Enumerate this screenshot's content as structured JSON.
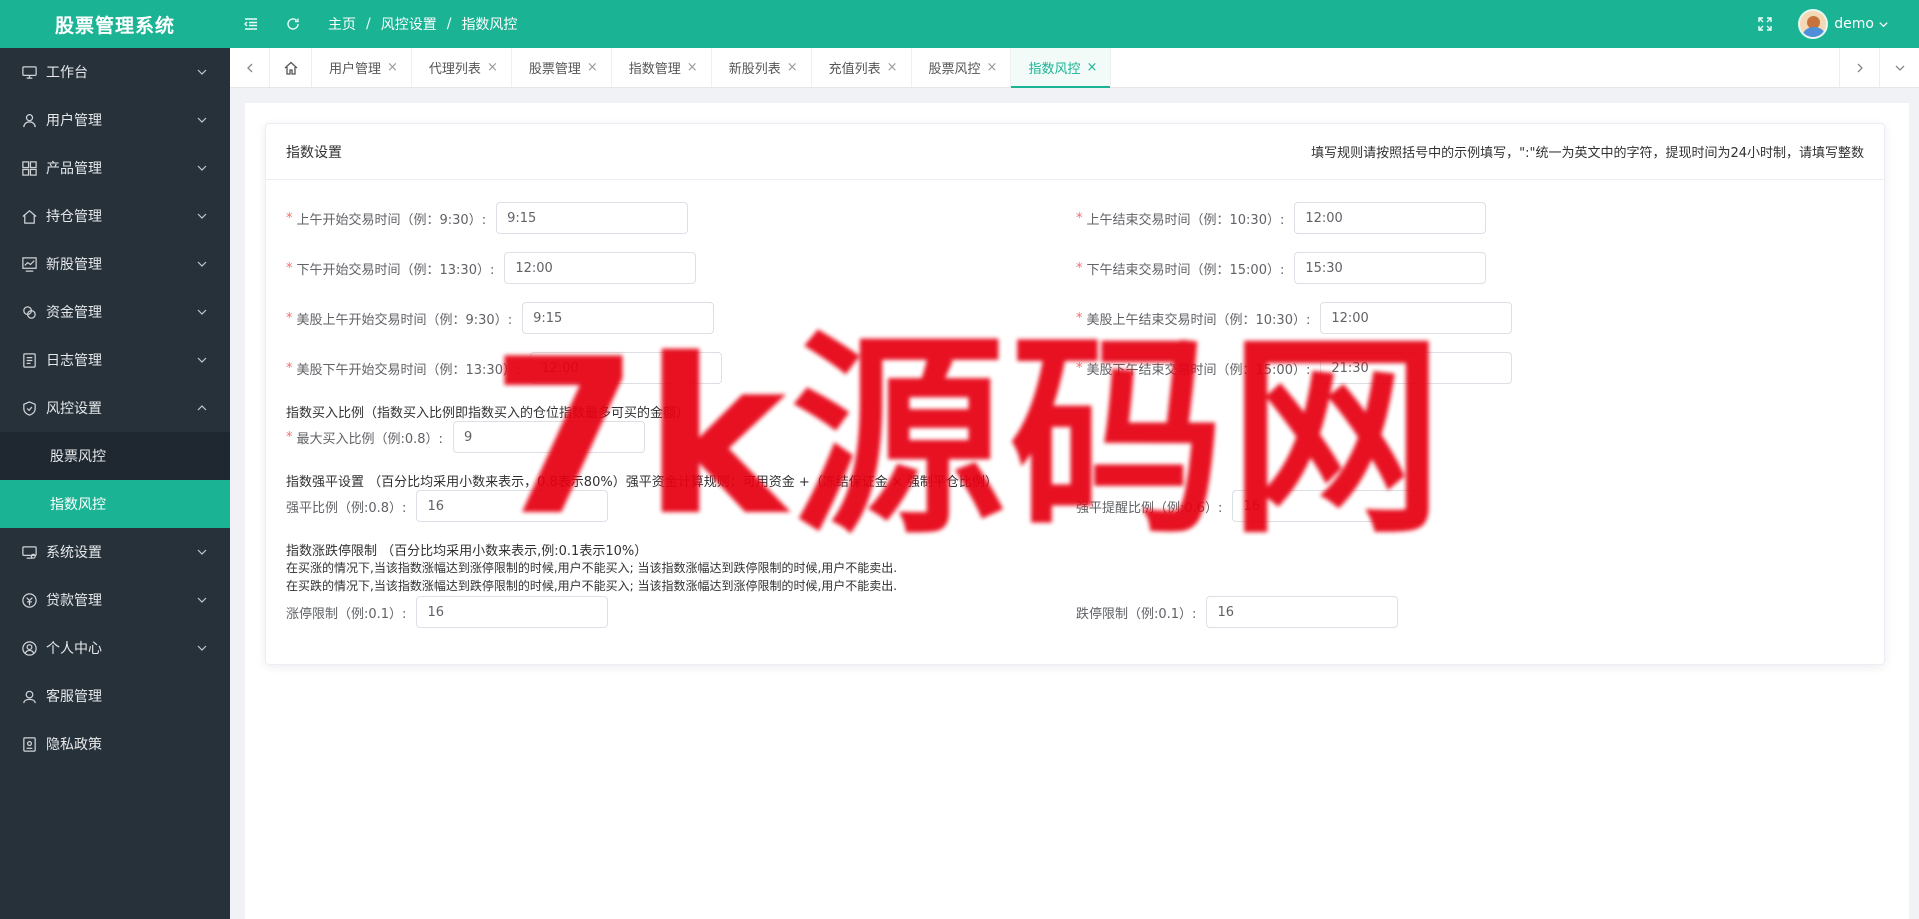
{
  "app": {
    "title": "股票管理系统"
  },
  "header": {
    "breadcrumb": [
      "主页",
      "风控设置",
      "指数风控"
    ],
    "username": "demo",
    "icons": [
      "menu-fold-icon",
      "refresh-icon",
      "fullscreen-icon",
      "user-avatar"
    ]
  },
  "sidebar": {
    "items": [
      {
        "label": "工作台",
        "icon": "monitor-icon",
        "expanded": false
      },
      {
        "label": "用户管理",
        "icon": "user-icon",
        "expanded": false
      },
      {
        "label": "产品管理",
        "icon": "grid-icon",
        "expanded": false
      },
      {
        "label": "持仓管理",
        "icon": "home-icon",
        "expanded": false
      },
      {
        "label": "新股管理",
        "icon": "chart-icon",
        "expanded": false
      },
      {
        "label": "资金管理",
        "icon": "coins-icon",
        "expanded": false
      },
      {
        "label": "日志管理",
        "icon": "log-icon",
        "expanded": false
      },
      {
        "label": "风控设置",
        "icon": "shield-icon",
        "expanded": true
      },
      {
        "label": "系统设置",
        "icon": "settings-monitor-icon",
        "expanded": false
      },
      {
        "label": "贷款管理",
        "icon": "loan-icon",
        "expanded": false
      },
      {
        "label": "个人中心",
        "icon": "person-circle-icon",
        "expanded": false
      },
      {
        "label": "客服管理",
        "icon": "service-icon",
        "expanded": false
      },
      {
        "label": "隐私政策",
        "icon": "privacy-icon",
        "expanded": false
      }
    ],
    "sub_items": [
      {
        "label": "股票风控",
        "active": false
      },
      {
        "label": "指数风控",
        "active": true
      }
    ]
  },
  "tabs": {
    "items": [
      {
        "label": "用户管理",
        "active": false
      },
      {
        "label": "代理列表",
        "active": false
      },
      {
        "label": "股票管理",
        "active": false
      },
      {
        "label": "指数管理",
        "active": false
      },
      {
        "label": "新股列表",
        "active": false
      },
      {
        "label": "充值列表",
        "active": false
      },
      {
        "label": "股票风控",
        "active": false
      },
      {
        "label": "指数风控",
        "active": true
      }
    ],
    "close_glyph": "×"
  },
  "card": {
    "title": "指数设置",
    "rule": "填写规则请按照括号中的示例填写，\":\"统一为英文中的字符，提现时间为24小时制，请填写整数"
  },
  "form": {
    "am_start_label": "上午开始交易时间（例：9:30）:",
    "am_start_value": "9:15",
    "am_end_label": "上午结束交易时间（例：10:30）:",
    "am_end_value": "12:00",
    "pm_start_label": "下午开始交易时间（例：13:30）:",
    "pm_start_value": "12:00",
    "pm_end_label": "下午结束交易时间（例：15:00）:",
    "pm_end_value": "15:30",
    "us_am_start_label": "美股上午开始交易时间（例：9:30）:",
    "us_am_start_value": "9:15",
    "us_am_end_label": "美股上午结束交易时间（例：10:30）:",
    "us_am_end_value": "12:00",
    "us_pm_start_label": "美股下午开始交易时间（例：13:30）:",
    "us_pm_start_value": "12:00",
    "us_pm_end_label": "美股下午结束交易时间（例：15:00）:",
    "us_pm_end_value": "21:30",
    "buy_ratio_note": "指数买入比例（指数买入比例即指数买入的仓位指数最多可买的金额）",
    "max_buy_label": "最大买入比例（例:0.8）:",
    "max_buy_value": "9",
    "force_note": "指数强平设置 （百分比均采用小数来表示，0.8表示80%）强平资金计算规则：可用资金 +（冻结保证金 × 强制平仓比例）",
    "force_label": "强平比例（例:0.8）:",
    "force_value": "16",
    "force_remind_label": "强平提醒比例（例:0.6）:",
    "force_remind_value": "16",
    "limit_note": "指数涨跌停限制 （百分比均采用小数来表示,例:0.1表示10%）",
    "limit_note_up": "在买涨的情况下,当该指数涨幅达到涨停限制的时候,用户不能买入; 当该指数涨幅达到跌停限制的时候,用户不能卖出.",
    "limit_note_down": "在买跌的情况下,当该指数涨幅达到跌停限制的时候,用户不能买入; 当该指数涨幅达到涨停限制的时候,用户不能卖出.",
    "up_limit_label": "涨停限制（例:0.1）:",
    "up_limit_value": "16",
    "down_limit_label": "跌停限制（例:0.1）:",
    "down_limit_value": "16"
  },
  "watermark": {
    "text": "7k源码网",
    "color": "#e60012"
  },
  "colors": {
    "brand": "#1ab394",
    "sidebar": "#27313a",
    "required": "#f56c6c"
  }
}
